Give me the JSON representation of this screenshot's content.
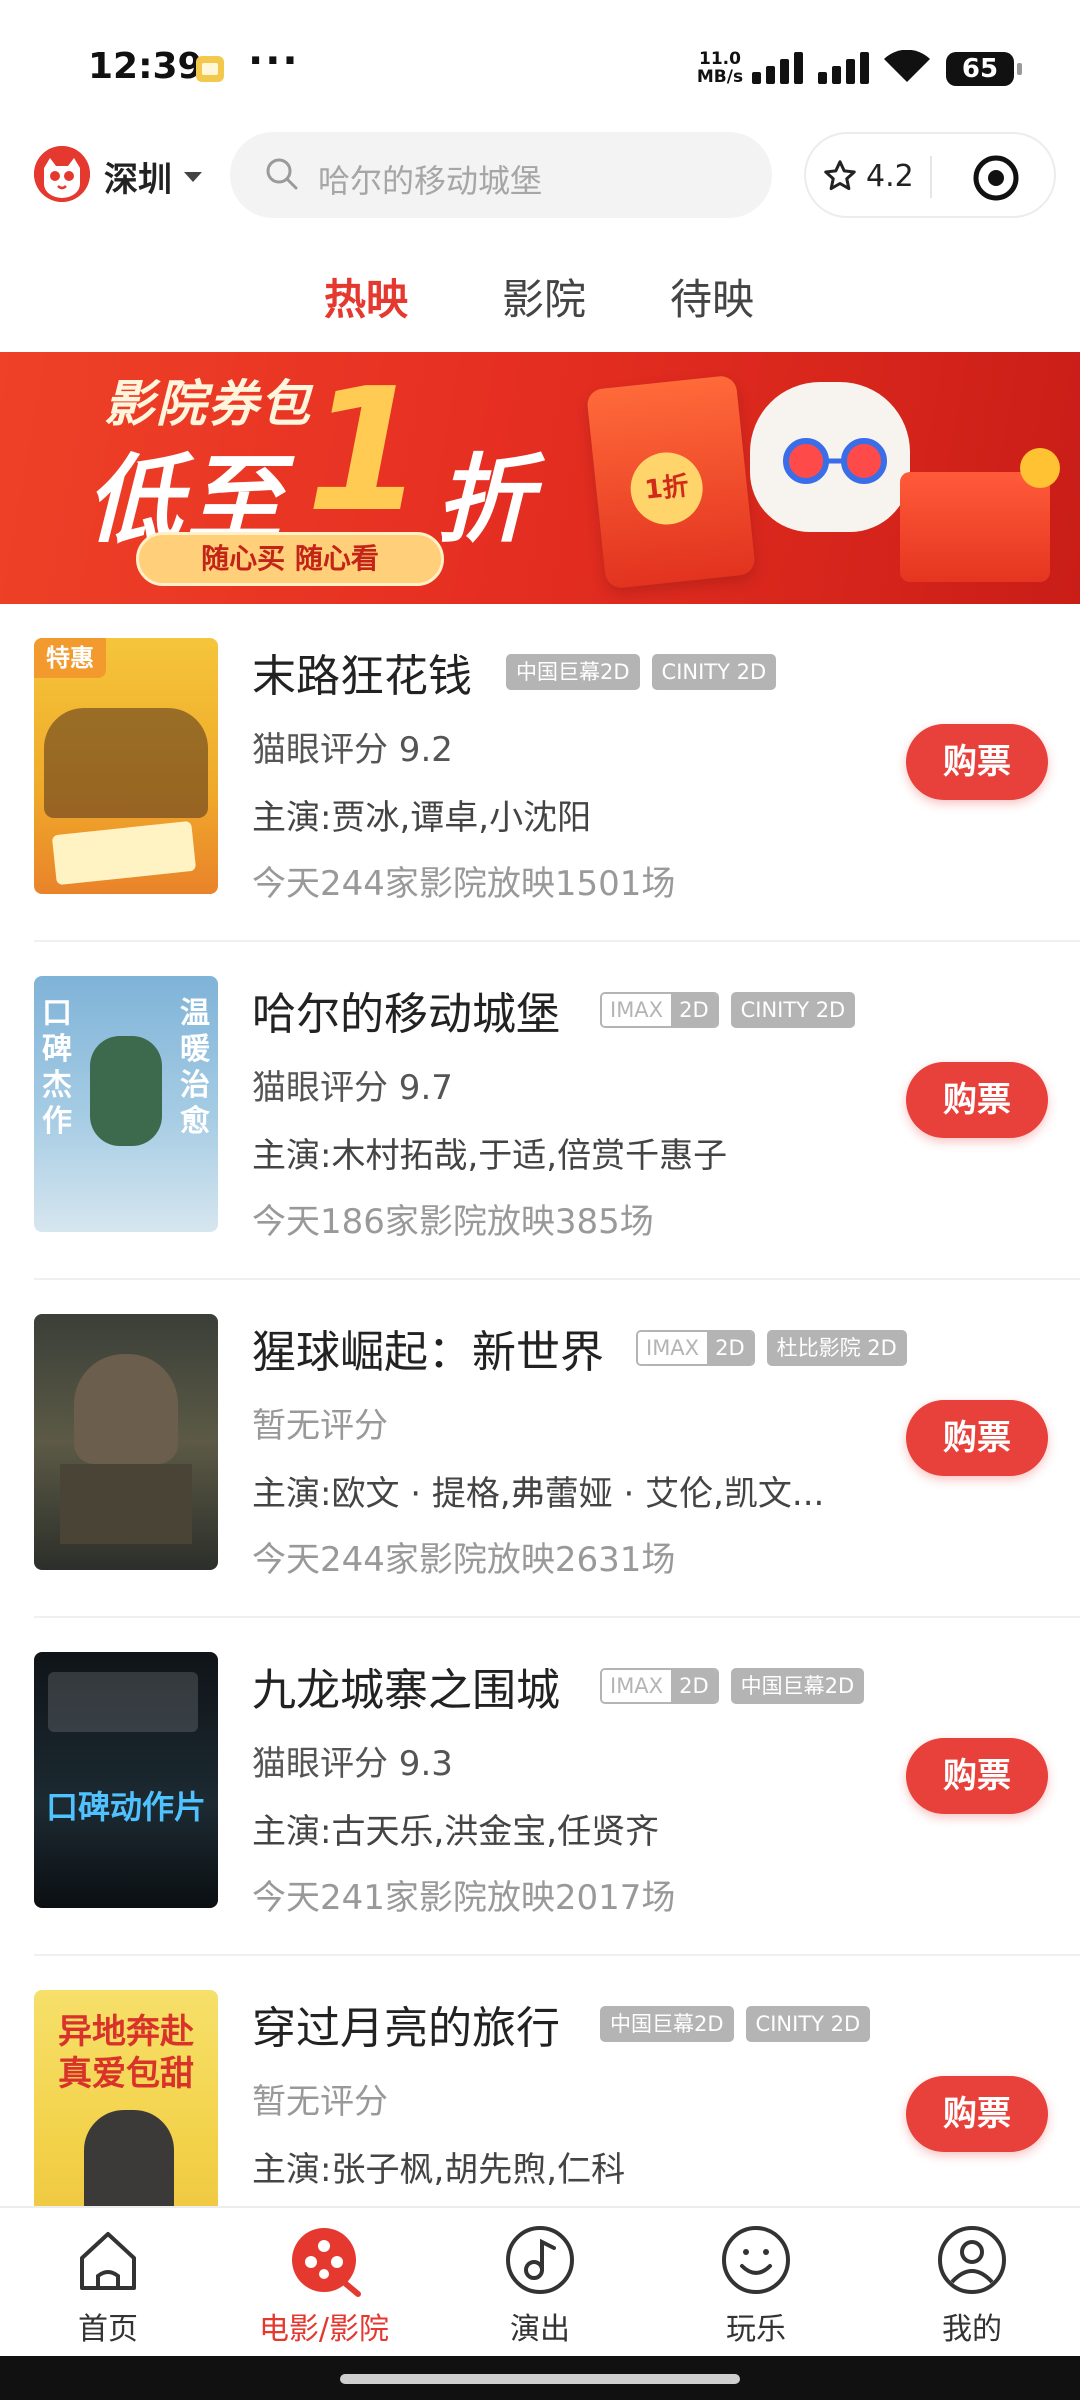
{
  "status_bar": {
    "time": "12:39",
    "more": "···",
    "net_speed_value": "11.0",
    "net_speed_unit": "MB/s",
    "battery": "65"
  },
  "header": {
    "city": "深圳",
    "search_placeholder": "哈尔的移动城堡",
    "rating": "4.2",
    "icons": {
      "logo": "maoyan-cat-logo",
      "search": "search-icon",
      "star": "star-icon",
      "target": "target-icon"
    }
  },
  "tabs": [
    {
      "label": "热映",
      "active": true
    },
    {
      "label": "影院",
      "active": false
    },
    {
      "label": "待映",
      "active": false
    }
  ],
  "banner": {
    "line1": "影院券包",
    "line2": "低至",
    "big_number": "1",
    "line2_suffix": "折",
    "button": "随心买 随心看",
    "envelope_label": "1折"
  },
  "movies": [
    {
      "title": "末路狂花钱",
      "badge": "特惠",
      "tags": [
        {
          "type": "plain",
          "text": "中国巨幕2D"
        },
        {
          "type": "plain",
          "text": "CINITY 2D"
        }
      ],
      "score": "猫眼评分 9.2",
      "cast": "主演:贾冰,谭卓,小沈阳",
      "shows": "今天244家影院放映1501场",
      "button": "购票"
    },
    {
      "title": "哈尔的移动城堡",
      "tags": [
        {
          "type": "imax",
          "left": "IMAX",
          "right": "2D"
        },
        {
          "type": "plain",
          "text": "CINITY 2D"
        }
      ],
      "score": "猫眼评分 9.7",
      "cast": "主演:木村拓哉,于适,倍赏千惠子",
      "shows": "今天186家影院放映385场",
      "button": "购票",
      "poster_text_left": "口碑杰作",
      "poster_text_right": "温暖治愈"
    },
    {
      "title": "猩球崛起：新世界",
      "tags": [
        {
          "type": "imax",
          "left": "IMAX",
          "right": "2D"
        },
        {
          "type": "plain",
          "text": "杜比影院 2D"
        }
      ],
      "score": "暂无评分",
      "cast": "主演:欧文 · 提格,弗蕾娅 · 艾伦,凯文...",
      "shows": "今天244家影院放映2631场",
      "button": "购票"
    },
    {
      "title": "九龙城寨之围城",
      "tags": [
        {
          "type": "imax",
          "left": "IMAX",
          "right": "2D"
        },
        {
          "type": "plain",
          "text": "中国巨幕2D"
        }
      ],
      "score": "猫眼评分 9.3",
      "cast": "主演:古天乐,洪金宝,任贤齐",
      "shows": "今天241家影院放映2017场",
      "button": "购票",
      "poster_text": "口碑动作片"
    },
    {
      "title": "穿过月亮的旅行",
      "tags": [
        {
          "type": "plain",
          "text": "中国巨幕2D"
        },
        {
          "type": "plain",
          "text": "CINITY 2D"
        }
      ],
      "score": "暂无评分",
      "cast": "主演:张子枫,胡先煦,仁科",
      "shows": "",
      "button": "购票",
      "poster_text_1": "异地奔赴",
      "poster_text_2": "真爱包甜"
    }
  ],
  "bottom_nav": [
    {
      "label": "首页",
      "icon": "home-icon",
      "active": false
    },
    {
      "label": "电影/影院",
      "icon": "film-reel-icon",
      "active": true
    },
    {
      "label": "演出",
      "icon": "music-note-icon",
      "active": false
    },
    {
      "label": "玩乐",
      "icon": "smile-icon",
      "active": false
    },
    {
      "label": "我的",
      "icon": "profile-icon",
      "active": false
    }
  ],
  "colors": {
    "accent": "#e5382f",
    "buy_button": "#e8403a",
    "tag_gray": "#b4b4b4"
  }
}
